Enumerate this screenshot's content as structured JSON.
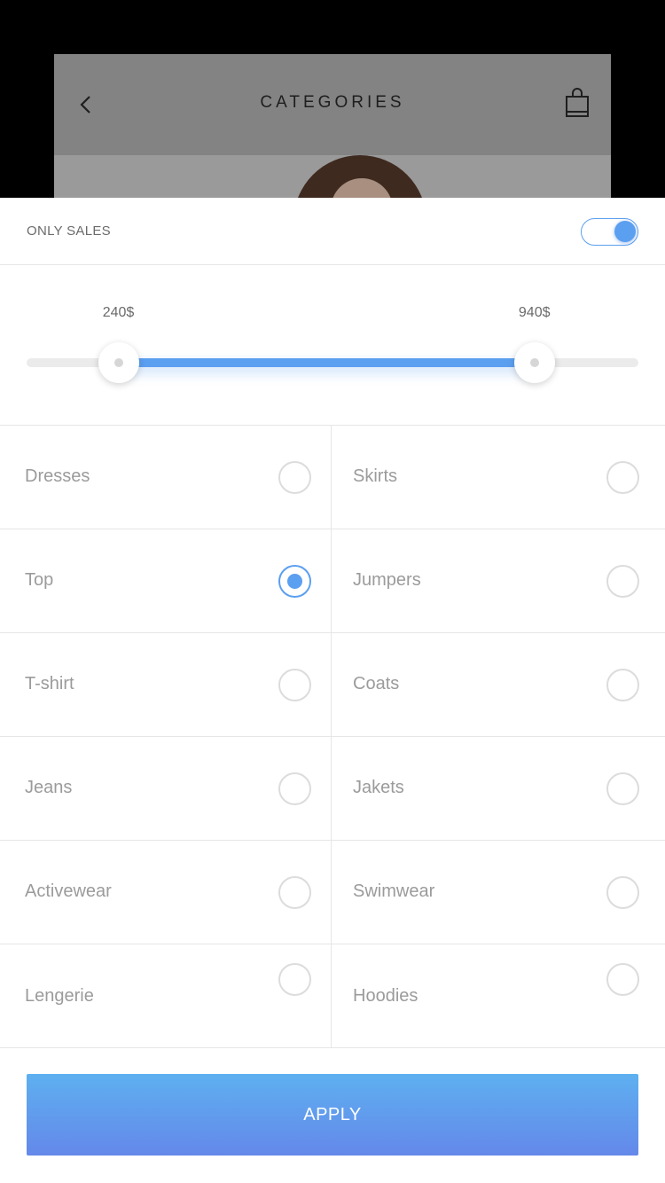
{
  "background_screen": {
    "title": "CATEGORIES",
    "back_icon": "chevron-left-icon",
    "bag_icon": "shopping-bag-icon"
  },
  "filters": {
    "only_sales": {
      "label": "ONLY SALES",
      "enabled": true
    },
    "price": {
      "min_label": "240$",
      "max_label": "940$",
      "range_min": 0,
      "range_max": 1000,
      "selected_min": 150,
      "selected_max": 830
    },
    "categories": [
      {
        "left": {
          "label": "Dresses",
          "checked": false
        },
        "right": {
          "label": "Skirts",
          "checked": false
        }
      },
      {
        "left": {
          "label": "Top",
          "checked": true
        },
        "right": {
          "label": "Jumpers",
          "checked": false
        }
      },
      {
        "left": {
          "label": "T-shirt",
          "checked": false
        },
        "right": {
          "label": "Coats",
          "checked": false
        }
      },
      {
        "left": {
          "label": "Jeans",
          "checked": false
        },
        "right": {
          "label": "Jakets",
          "checked": false
        }
      },
      {
        "left": {
          "label": "Activewear",
          "checked": false
        },
        "right": {
          "label": "Swimwear",
          "checked": false
        }
      },
      {
        "left": {
          "label": "Lengerie",
          "checked": false
        },
        "right": {
          "label": "Hoodies",
          "checked": false
        }
      }
    ]
  },
  "apply_label": "APPLY",
  "colors": {
    "accent": "#5b9ff0",
    "gradient_top": "#5eb0f0",
    "gradient_bottom": "#6488ea"
  }
}
